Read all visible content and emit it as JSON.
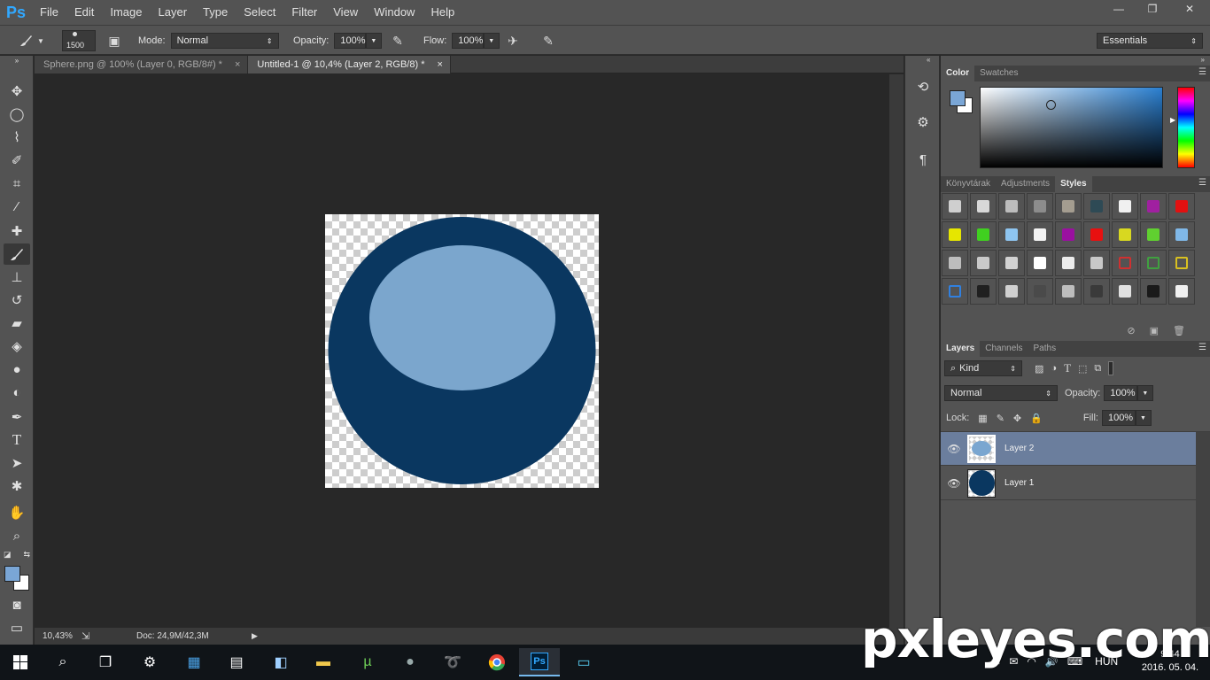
{
  "app": {
    "logo": "Ps",
    "accent": "#31a8ff"
  },
  "menu": [
    "File",
    "Edit",
    "Image",
    "Layer",
    "Type",
    "Select",
    "Filter",
    "View",
    "Window",
    "Help"
  ],
  "window_controls": {
    "minimize": "—",
    "restore": "❐",
    "close": "✕"
  },
  "options": {
    "brush_size": "1500",
    "mode_label": "Mode:",
    "mode_value": "Normal",
    "opacity_label": "Opacity:",
    "opacity_value": "100%",
    "flow_label": "Flow:",
    "flow_value": "100%",
    "workspace": "Essentials"
  },
  "tabs": [
    {
      "label": "Sphere.png @ 100% (Layer 0, RGB/8#) *",
      "close": "×",
      "active": false
    },
    {
      "label": "Untitled-1 @ 10,4% (Layer 2, RGB/8) *",
      "close": "×",
      "active": true
    }
  ],
  "status": {
    "zoom": "10,43%",
    "doc": "Doc: 24,9M/42,3M"
  },
  "color_panel": {
    "tabs": [
      "Color",
      "Swatches"
    ],
    "foreground": "#7aa6d6",
    "background": "#ffffff"
  },
  "styles_panel": {
    "tabs": [
      "Könyvtárak",
      "Adjustments",
      "Styles"
    ]
  },
  "layers_panel": {
    "tabs": [
      "Layers",
      "Channels",
      "Paths"
    ],
    "kind": "Kind",
    "blend_mode": "Normal",
    "opacity_label": "Opacity:",
    "opacity_value": "100%",
    "lock_label": "Lock:",
    "fill_label": "Fill:",
    "fill_value": "100%",
    "layers": [
      {
        "name": "Layer 2",
        "selected": true,
        "color": "#7aa6d0"
      },
      {
        "name": "Layer 1",
        "selected": false,
        "color": "#0a3760"
      }
    ]
  },
  "canvas": {
    "outer_color": "#0a3760",
    "inner_color": "#7ba6cd"
  },
  "taskbar": {
    "language": "HUN",
    "time": "9:44",
    "date": "2016. 05. 04."
  },
  "watermark": "pxleyes.com"
}
